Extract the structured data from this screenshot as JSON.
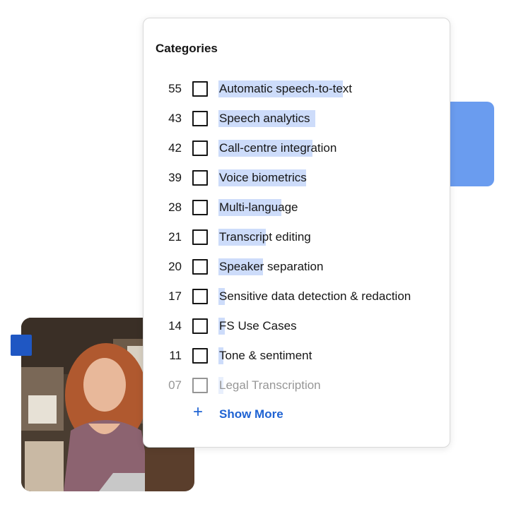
{
  "card": {
    "title": "Categories",
    "items": [
      {
        "count": "55",
        "label": "Automatic speech-to-text",
        "bar": 0.95,
        "faded": false
      },
      {
        "count": "43",
        "label": "Speech analytics",
        "bar": 0.74,
        "faded": false
      },
      {
        "count": "42",
        "label": "Call-centre integration",
        "bar": 0.72,
        "faded": false
      },
      {
        "count": "39",
        "label": "Voice biometrics",
        "bar": 0.67,
        "faded": false
      },
      {
        "count": "28",
        "label": "Multi-language",
        "bar": 0.48,
        "faded": false
      },
      {
        "count": "21",
        "label": "Transcript editing",
        "bar": 0.36,
        "faded": false
      },
      {
        "count": "20",
        "label": "Speaker separation",
        "bar": 0.34,
        "faded": false
      },
      {
        "count": "17",
        "label": "Sensitive data detection & redaction",
        "bar": 0.05,
        "faded": false
      },
      {
        "count": "14",
        "label": "FS Use Cases",
        "bar": 0.05,
        "faded": false
      },
      {
        "count": "11",
        "label": "Tone & sentiment",
        "bar": 0.04,
        "faded": false
      },
      {
        "count": "07",
        "label": "Legal Transcription",
        "bar": 0.04,
        "faded": true
      }
    ],
    "show_more": {
      "icon": "plus-icon",
      "label": "Show More"
    }
  },
  "colors": {
    "accent": "#1f63d3",
    "bar": "#cddcfa",
    "decor_square": "#6a9cef",
    "decor_small_square": "#1f57c3"
  }
}
